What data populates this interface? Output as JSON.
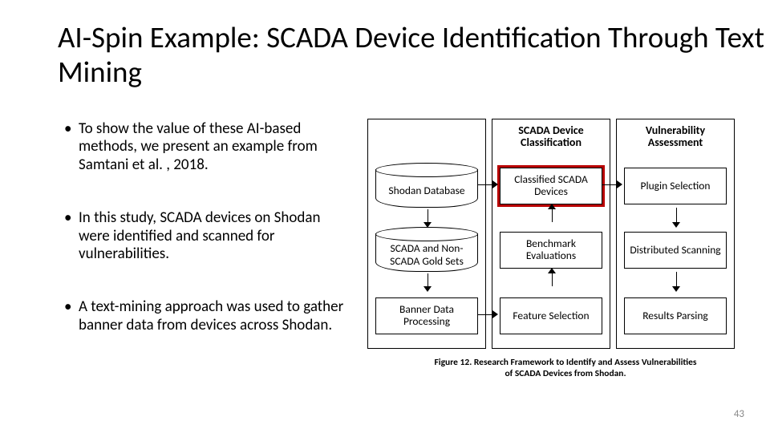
{
  "title": "AI-Spin Example: SCADA Device Identification Through Text Mining",
  "bullets": [
    "To show the value of these AI-based methods, we present an example from Samtani et al. , 2018.",
    "In this study, SCADA devices on Shodan were identified and scanned for vulnerabilities.",
    "A text-mining approach was used to gather banner data from devices across Shodan."
  ],
  "diagram": {
    "col1": {
      "header": "",
      "items": [
        "Shodan Database",
        "SCADA and Non-SCADA Gold Sets",
        "Banner Data Processing"
      ]
    },
    "col2": {
      "header": "SCADA Device Classification",
      "items": [
        "Classified SCADA Devices",
        "Benchmark Evaluations",
        "Feature Selection"
      ]
    },
    "col3": {
      "header": "Vulnerability Assessment",
      "items": [
        "Plugin Selection",
        "Distributed Scanning",
        "Results Parsing"
      ]
    }
  },
  "caption": "Figure 12. Research Framework to Identify and Assess Vulnerabilities of SCADA Devices from Shodan.",
  "page_number": "43"
}
